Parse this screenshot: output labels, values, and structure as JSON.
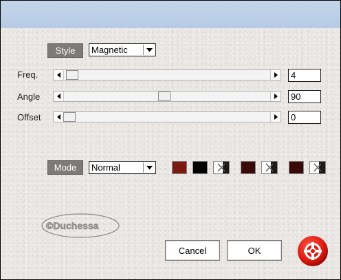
{
  "style": {
    "label": "Style",
    "value": "Magnetic"
  },
  "rows": [
    {
      "label": "Freq.",
      "value": "4"
    },
    {
      "label": "Angle",
      "value": "90"
    },
    {
      "label": "Offset",
      "value": "0"
    }
  ],
  "mode": {
    "label": "Mode",
    "value": "Normal"
  },
  "swatches": [
    "#7a1a10",
    "#000000",
    "#3a0a08",
    "#3a0a08"
  ],
  "watermark": "©Duchessa",
  "buttons": {
    "cancel": "Cancel",
    "ok": "OK"
  },
  "icons": {
    "help": "help-lifebuoy-icon"
  }
}
